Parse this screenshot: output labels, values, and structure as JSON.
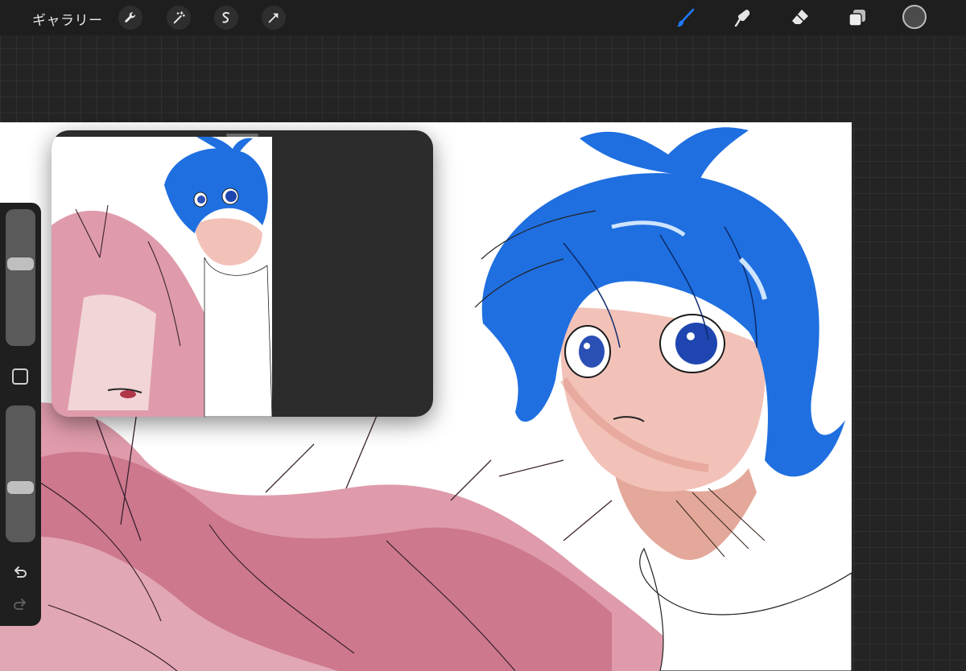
{
  "toolbar": {
    "gallery_label": "ギャラリー",
    "left_tools": [
      "wrench-icon",
      "magic-wand-icon",
      "selection-icon",
      "transform-icon"
    ],
    "right_tools": [
      "brush-icon",
      "smudge-icon",
      "eraser-icon",
      "layers-icon"
    ],
    "active_tool": "brush-icon",
    "accent_color": "#1e7bff",
    "current_color": "#4b4b4b"
  },
  "sidebar": {
    "brush_size_level": 0.4,
    "opacity_level": 0.6,
    "controls": [
      "brush-size-slider",
      "modify-button",
      "opacity-slider",
      "undo-icon",
      "redo-icon"
    ]
  },
  "reference_window": {
    "visible": true
  }
}
